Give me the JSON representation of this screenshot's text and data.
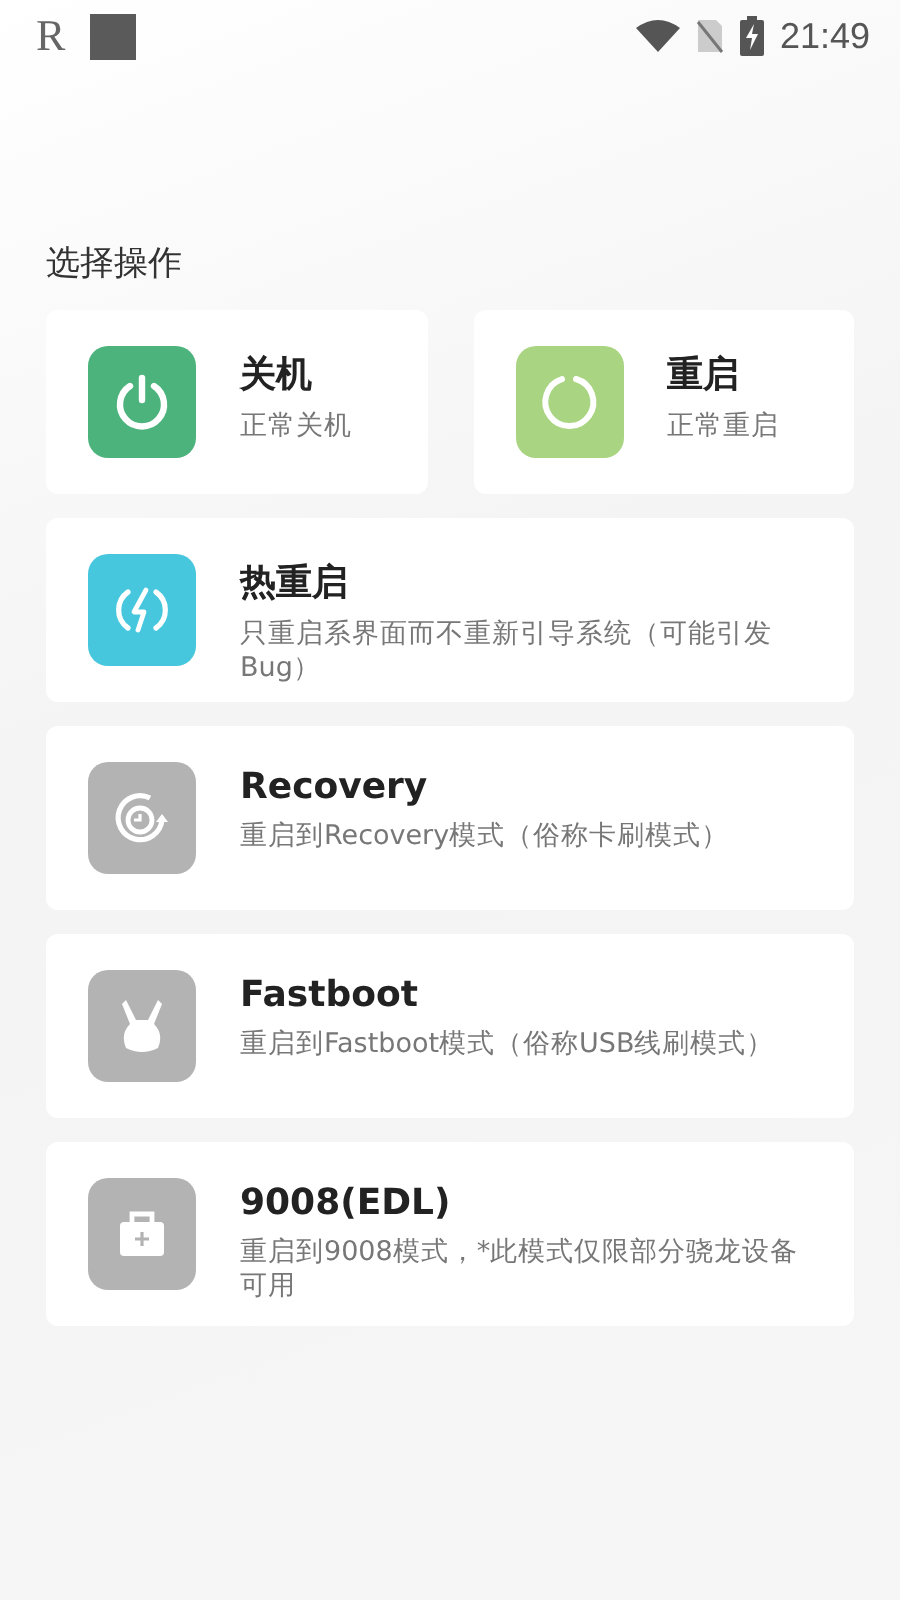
{
  "status_bar": {
    "left_glyph": "R",
    "time": "21:49"
  },
  "section_title": "选择操作",
  "top_actions": [
    {
      "kind": "power",
      "title": "关机",
      "description": "正常关机",
      "color": "#4db37c"
    },
    {
      "kind": "restart",
      "title": "重启",
      "description": "正常重启",
      "color": "#a9d482"
    }
  ],
  "actions": [
    {
      "kind": "hot",
      "title": "热重启",
      "description": "只重启系界面而不重新引导系统（可能引发Bug）",
      "color": "#47c7dd"
    },
    {
      "kind": "recovery",
      "title": "Recovery",
      "description": "重启到Recovery模式（俗称卡刷模式）",
      "color": "#b3b3b3"
    },
    {
      "kind": "fastboot",
      "title": "Fastboot",
      "description": "重启到Fastboot模式（俗称USB线刷模式）",
      "color": "#b3b3b3"
    },
    {
      "kind": "edl",
      "title": "9008(EDL)",
      "description": "重启到9008模式，*此模式仅限部分骁龙设备可用",
      "color": "#b3b3b3"
    }
  ]
}
